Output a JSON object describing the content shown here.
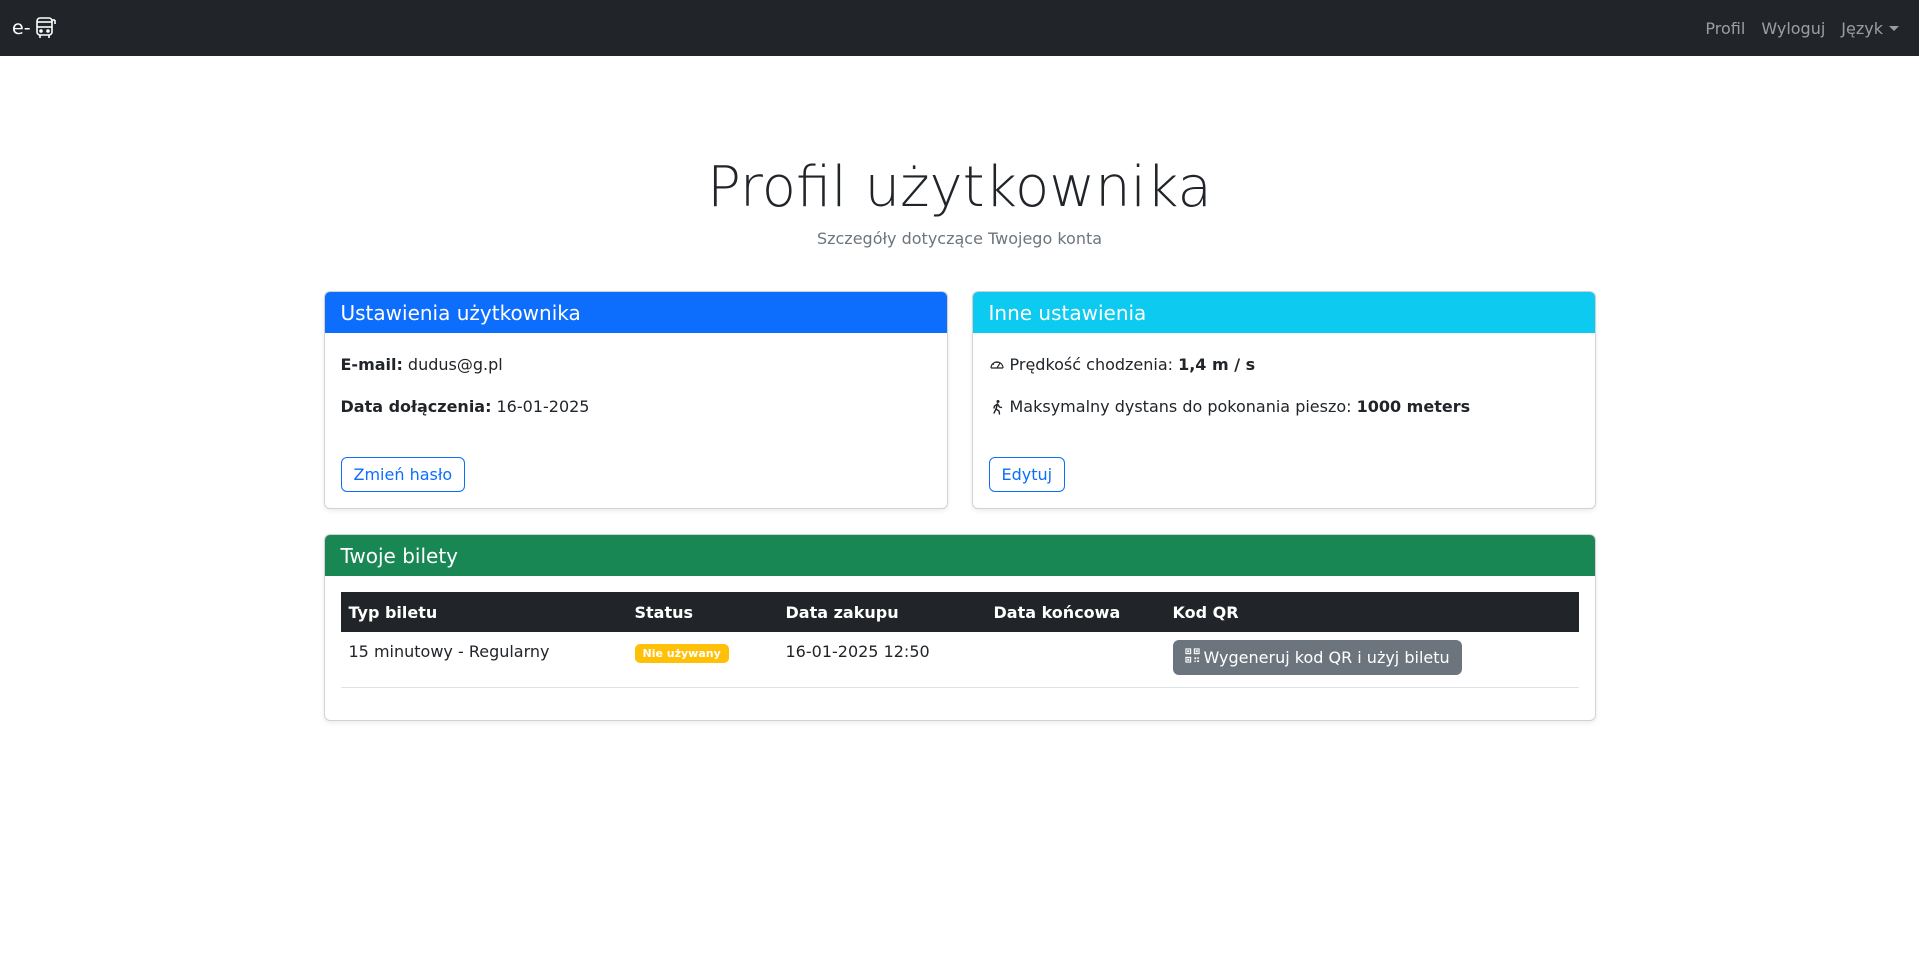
{
  "navbar": {
    "brand_text": "e-",
    "brand_icon": "bus-icon",
    "links": {
      "profile": "Profil",
      "logout": "Wyloguj",
      "language": "Język"
    }
  },
  "header": {
    "title": "Profil użytkownika",
    "subtitle": "Szczegóły dotyczące Twojego konta"
  },
  "user_settings": {
    "title": "Ustawienia użytkownika",
    "email_label": "E-mail:",
    "email_value": "dudus@g.pl",
    "joined_label": "Data dołączenia:",
    "joined_value": "16-01-2025",
    "change_password_button": "Zmień hasło",
    "header_color": "#0d6efd"
  },
  "other_settings": {
    "title": "Inne ustawienia",
    "walking_speed_label": "Prędkość chodzenia:",
    "walking_speed_value": "1,4 m / s",
    "walking_speed_icon": "speedometer-icon",
    "max_distance_label": "Maksymalny dystans do pokonania pieszo:",
    "max_distance_value": "1000 meters",
    "max_distance_icon": "person-walking-icon",
    "edit_button": "Edytuj",
    "header_color": "#0dcaf0"
  },
  "tickets": {
    "title": "Twoje bilety",
    "header_color": "#198754",
    "columns": [
      "Typ biletu",
      "Status",
      "Data zakupu",
      "Data końcowa",
      "Kod QR"
    ],
    "rows": [
      {
        "type": "15 minutowy - Regularny",
        "status": "Nie używany",
        "purchase_date": "16-01-2025 12:50",
        "end_date": "",
        "qr_button": "Wygeneruj kod QR i użyj biletu",
        "qr_icon": "qr-code-icon"
      }
    ]
  }
}
